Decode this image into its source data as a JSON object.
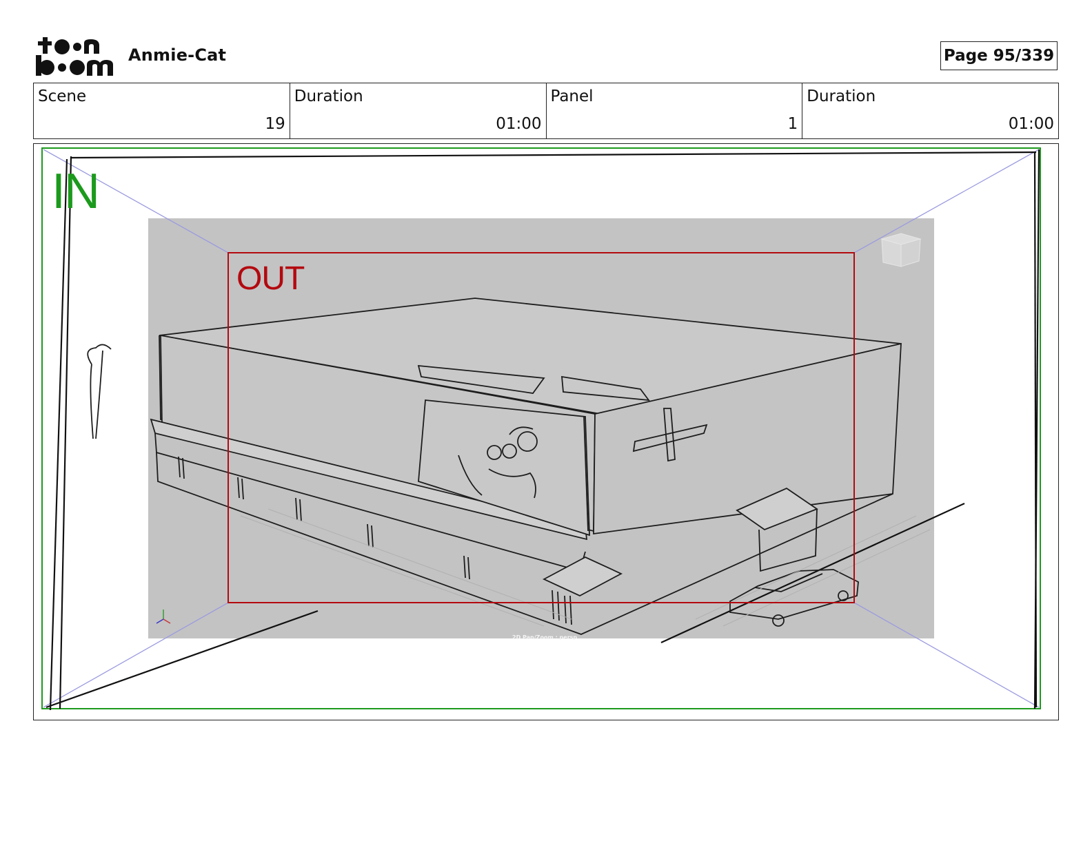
{
  "header": {
    "logo_text": "toon boom",
    "project_title": "Anmie-Cat",
    "page_label": "Page",
    "page_number": "95/339"
  },
  "info": [
    {
      "label": "Scene",
      "value": "19"
    },
    {
      "label": "Duration",
      "value": "01:00"
    },
    {
      "label": "Panel",
      "value": "1"
    },
    {
      "label": "Duration",
      "value": "01:00"
    }
  ],
  "panel": {
    "in_label": "IN",
    "out_label": "OUT",
    "viewport_caption": "2D Pan/Zoom : persp"
  },
  "colors": {
    "in_frame": "#1c9a1c",
    "out_frame": "#b3090f",
    "viewport_bg": "#c3c3c3",
    "guide_lines": "#9b9be0"
  }
}
